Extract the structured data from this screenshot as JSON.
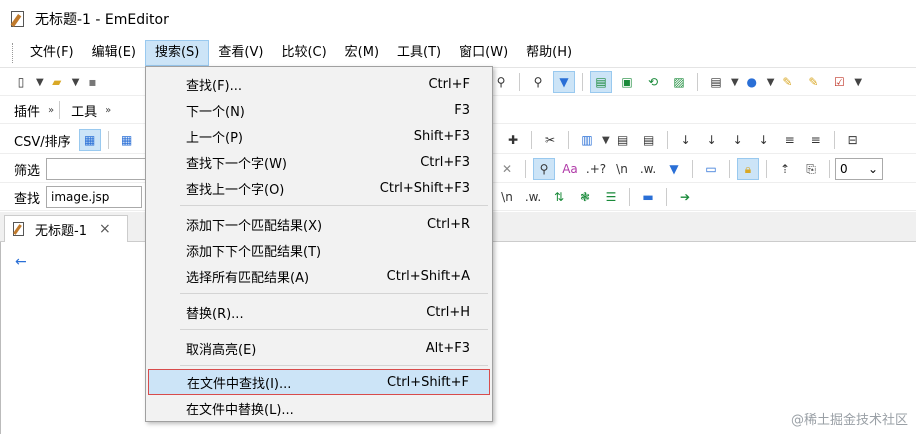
{
  "window": {
    "title": "无标题-1 - EmEditor"
  },
  "menubar": {
    "items": [
      {
        "label": "文件(F)"
      },
      {
        "label": "编辑(E)"
      },
      {
        "label": "搜索(S)"
      },
      {
        "label": "查看(V)"
      },
      {
        "label": "比较(C)"
      },
      {
        "label": "宏(M)"
      },
      {
        "label": "工具(T)"
      },
      {
        "label": "窗口(W)"
      },
      {
        "label": "帮助(H)"
      }
    ]
  },
  "toolbars": {
    "plugins_label": "插件",
    "tools_label": "工具",
    "csv_label": "CSV/排序",
    "filter_label": "筛选",
    "find_label": "查找",
    "find_value": "image.jsp",
    "combo_value": "0",
    "icons_row4": [
      "\\n",
      ".w.",
      "✕",
      "Aa",
      ".+?"
    ],
    "icons_row5": [
      "\\n",
      ".w."
    ]
  },
  "tab": {
    "label": "无标题-1",
    "close": "×"
  },
  "search_menu": {
    "items": [
      {
        "label": "查找(F)...",
        "shortcut": "Ctrl+F"
      },
      {
        "label": "下一个(N)",
        "shortcut": "F3"
      },
      {
        "label": "上一个(P)",
        "shortcut": "Shift+F3"
      },
      {
        "label": "查找下一个字(W)",
        "shortcut": "Ctrl+F3"
      },
      {
        "label": "查找上一个字(O)",
        "shortcut": "Ctrl+Shift+F3"
      },
      {
        "label": "添加下一个匹配结果(X)",
        "shortcut": "Ctrl+R"
      },
      {
        "label": "添加下下个匹配结果(T)",
        "shortcut": ""
      },
      {
        "label": "选择所有匹配结果(A)",
        "shortcut": "Ctrl+Shift+A"
      },
      {
        "label": "替换(R)...",
        "shortcut": "Ctrl+H"
      },
      {
        "label": "取消高亮(E)",
        "shortcut": "Alt+F3"
      },
      {
        "label": "在文件中查找(I)...",
        "shortcut": "Ctrl+Shift+F"
      },
      {
        "label": "在文件中替换(L)...",
        "shortcut": ""
      }
    ],
    "highlighted_index": 10
  },
  "watermark": "@稀土掘金技术社区",
  "colors": {
    "menu_highlight": "#cce4f7",
    "highlight_border": "#d84c4c"
  }
}
